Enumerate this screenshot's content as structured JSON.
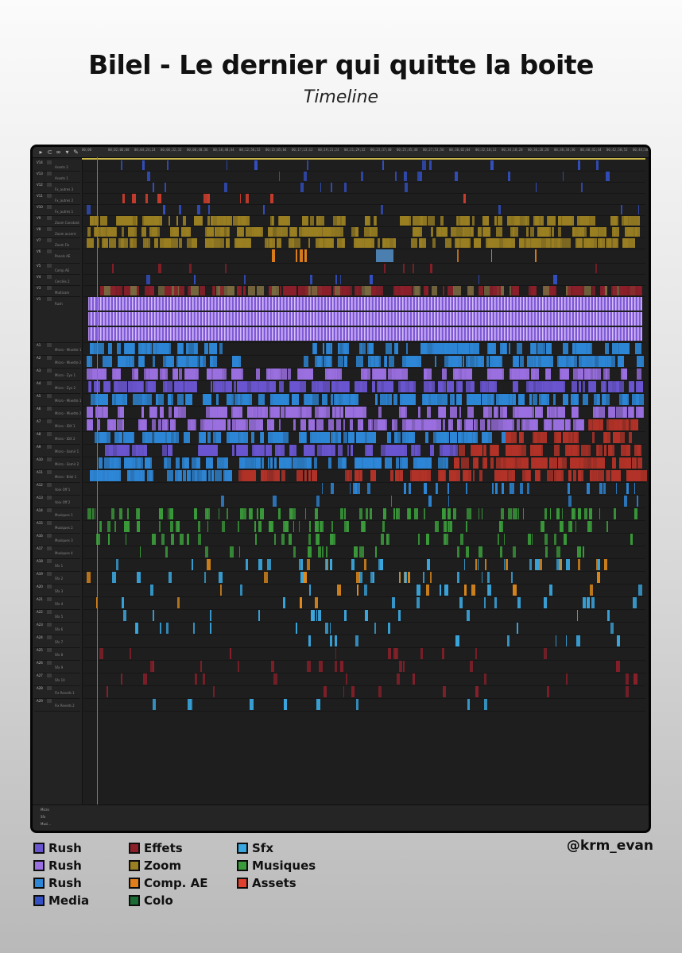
{
  "header": {
    "title": "Bilel - Le dernier qui quitte la boite",
    "subtitle": "Timeline"
  },
  "handle": "@krm_evan",
  "legend": [
    {
      "label": "Rush",
      "color": "#6a55d0"
    },
    {
      "label": "Rush",
      "color": "#9a6fe0"
    },
    {
      "label": "Rush",
      "color": "#2d86d6"
    },
    {
      "label": "Media",
      "color": "#3350c4"
    },
    {
      "label": "Effets",
      "color": "#8a1f2a"
    },
    {
      "label": "Zoom",
      "color": "#9a7f22"
    },
    {
      "label": "Comp. AE",
      "color": "#e07f1c"
    },
    {
      "label": "Colo",
      "color": "#1a6b34"
    },
    {
      "label": "Sfx",
      "color": "#3aa8e0"
    },
    {
      "label": "Musiques",
      "color": "#3a9b3a"
    },
    {
      "label": "Assets",
      "color": "#e0412e"
    }
  ],
  "timeline": {
    "ruler_ticks": [
      "00;00",
      "00;02;06;08",
      "00;04;24;24",
      "00;06;32;32",
      "00;08;40;36",
      "00;10;48;44",
      "00;12;56;52",
      "00;15;05;04",
      "00;17;13;12",
      "00;19;21;24",
      "00;21;29;32",
      "00;23;37;40",
      "00;25;45;48",
      "00;27;53;56",
      "00;30;02;04",
      "00;32;10;12",
      "00;34;18;20",
      "00;36;26;28",
      "00;38;34;36",
      "00;40;42;44",
      "00;42;50;52",
      "00;44;58;60"
    ],
    "tracks": [
      {
        "id": "V14",
        "name": "Assets 2"
      },
      {
        "id": "V13",
        "name": "Assets 1"
      },
      {
        "id": "V12",
        "name": "Fx_autres 3"
      },
      {
        "id": "V11",
        "name": "Fx_autres 2"
      },
      {
        "id": "V10",
        "name": "Fx_autres 1"
      },
      {
        "id": "V9",
        "name": "Zoom Constant"
      },
      {
        "id": "V8",
        "name": "Zoom accent"
      },
      {
        "id": "V7",
        "name": "Zoom Fix"
      },
      {
        "id": "V6",
        "name": "Panels AE"
      },
      {
        "id": "V5",
        "name": "Comp AE"
      },
      {
        "id": "V4",
        "name": "Cerclés 2"
      },
      {
        "id": "V3",
        "name": "Multicam"
      },
      {
        "id": "V1",
        "name": "Rush"
      },
      {
        "id": "A1",
        "name": "Micro - Mixette 1"
      },
      {
        "id": "A2",
        "name": "Micro - Mixette 2"
      },
      {
        "id": "A3",
        "name": "Micro - Zyx 1"
      },
      {
        "id": "A4",
        "name": "Micro - Zyx 2"
      },
      {
        "id": "A5",
        "name": "Micro - Mixette 1"
      },
      {
        "id": "A6",
        "name": "Micro - Mixette 2"
      },
      {
        "id": "A7",
        "name": "Micro - IDX 1"
      },
      {
        "id": "A8",
        "name": "Micro - IDX 2"
      },
      {
        "id": "A9",
        "name": "Micro - Samir 1"
      },
      {
        "id": "A10",
        "name": "Micro - Samir 2"
      },
      {
        "id": "A11",
        "name": "Micro - Bilel 1"
      },
      {
        "id": "A12",
        "name": "Voix Off 1"
      },
      {
        "id": "A13",
        "name": "Voix Off 2"
      },
      {
        "id": "A14",
        "name": "Musiques 1"
      },
      {
        "id": "A15",
        "name": "Musiques 2"
      },
      {
        "id": "A16",
        "name": "Musiques 3"
      },
      {
        "id": "A17",
        "name": "Musiques 4"
      },
      {
        "id": "A18",
        "name": "Sfx 1"
      },
      {
        "id": "A19",
        "name": "Sfx 2"
      },
      {
        "id": "A20",
        "name": "Sfx 3"
      },
      {
        "id": "A21",
        "name": "Sfx 4"
      },
      {
        "id": "A22",
        "name": "Sfx 5"
      },
      {
        "id": "A23",
        "name": "Sfx 6"
      },
      {
        "id": "A24",
        "name": "Sfx 7"
      },
      {
        "id": "A25",
        "name": "Sfx 8"
      },
      {
        "id": "A26",
        "name": "Sfx 9"
      },
      {
        "id": "A27",
        "name": "Sfx 10"
      },
      {
        "id": "A28",
        "name": "Fix Reverb 1"
      },
      {
        "id": "A29",
        "name": "Fix Reverb 2"
      }
    ],
    "bottom_tracks": [
      "Micro",
      "Sfx",
      "Musi..."
    ]
  }
}
